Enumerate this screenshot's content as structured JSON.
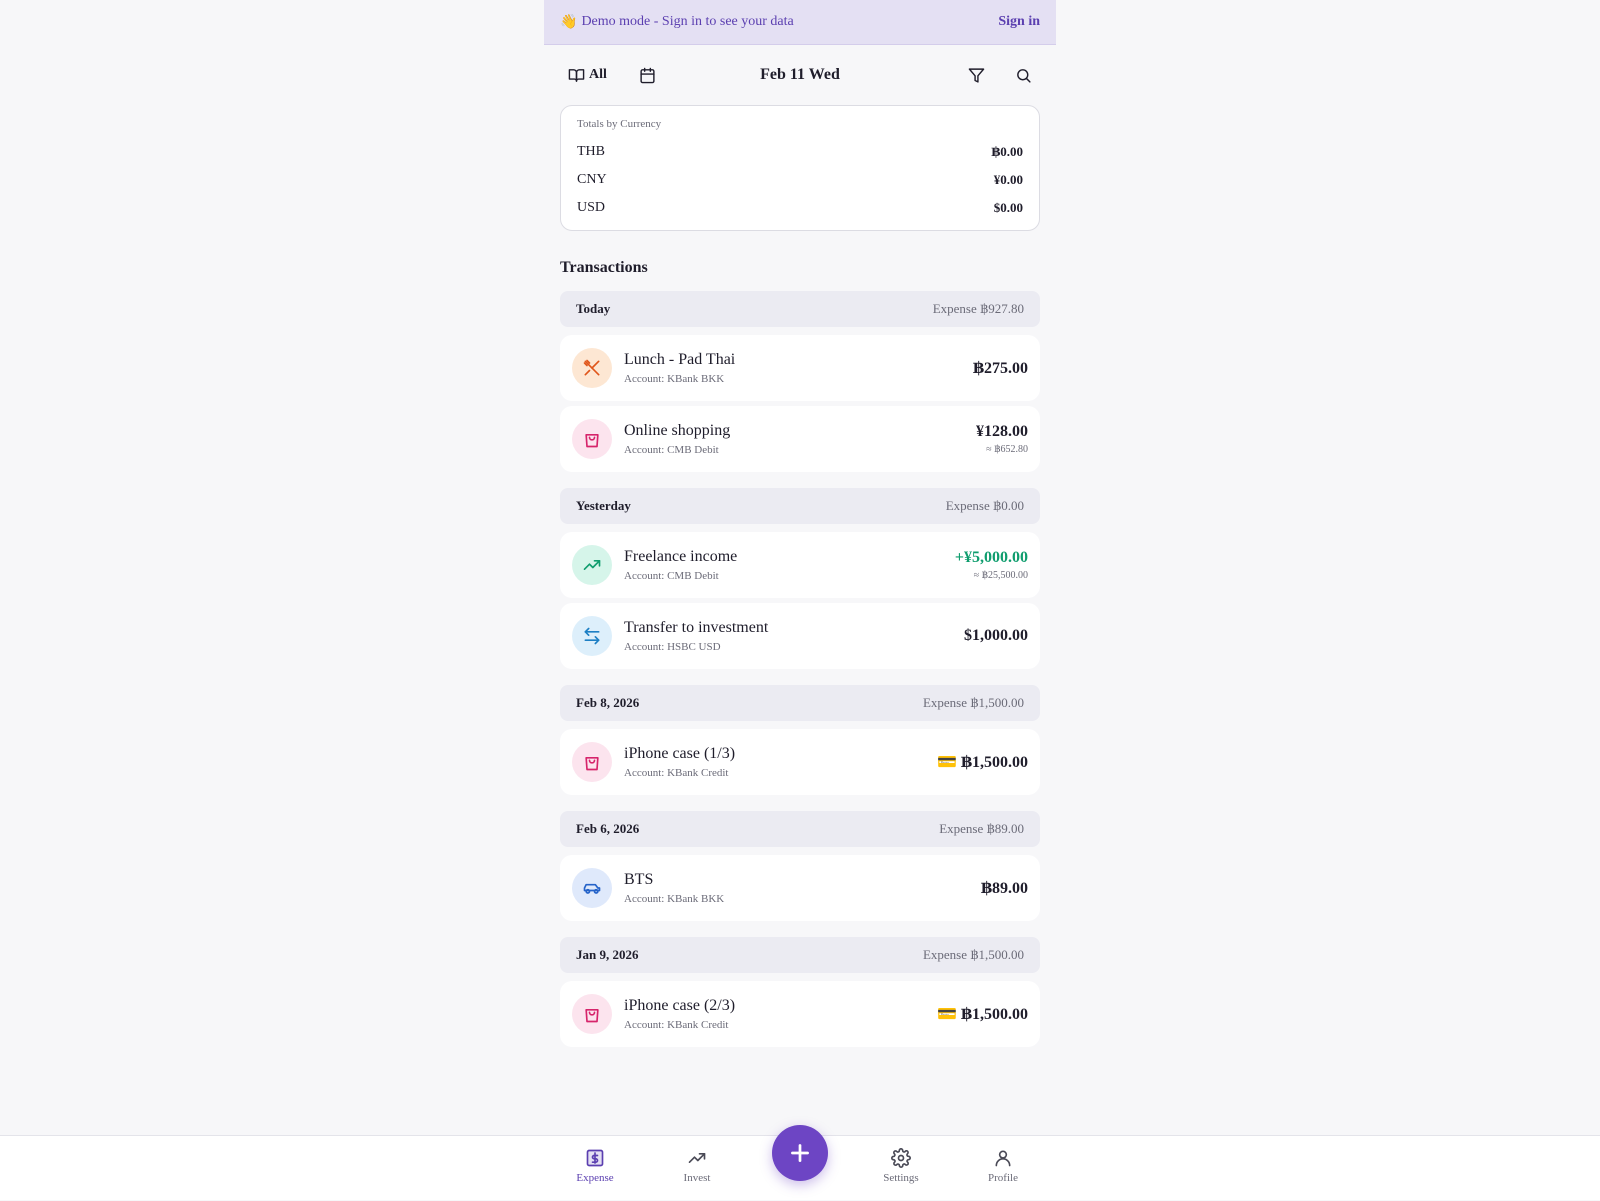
{
  "banner": {
    "emoji": "👋",
    "text": "Demo mode - Sign in to see your data",
    "signin": "Sign in"
  },
  "header": {
    "all_label": "All",
    "date": "Feb 11 Wed"
  },
  "totals": {
    "title": "Totals by Currency",
    "rows": [
      {
        "code": "THB",
        "amount": "฿0.00"
      },
      {
        "code": "CNY",
        "amount": "¥0.00"
      },
      {
        "code": "USD",
        "amount": "$0.00"
      }
    ]
  },
  "transactions_title": "Transactions",
  "groups": [
    {
      "label": "Today",
      "expense": "Expense ฿927.80",
      "items": [
        {
          "name": "Lunch - Pad Thai",
          "account": "Account: KBank BKK",
          "amount": "฿275.00",
          "sub": "",
          "icon": "utensils-icon",
          "type": "expense"
        },
        {
          "name": "Online shopping",
          "account": "Account: CMB Debit",
          "amount": "¥128.00",
          "sub": "≈ ฿652.80",
          "icon": "shopping-bag-icon",
          "type": "expense"
        }
      ]
    },
    {
      "label": "Yesterday",
      "expense": "Expense ฿0.00",
      "items": [
        {
          "name": "Freelance income",
          "account": "Account: CMB Debit",
          "amount": "+¥5,000.00",
          "sub": "≈ ฿25,500.00",
          "icon": "trending-up-icon",
          "type": "income"
        },
        {
          "name": "Transfer to investment",
          "account": "Account: HSBC USD",
          "amount": "$1,000.00",
          "sub": "",
          "icon": "transfer-icon",
          "type": "transfer"
        }
      ]
    },
    {
      "label": "Feb 8, 2026",
      "expense": "Expense ฿1,500.00",
      "items": [
        {
          "name": "iPhone case (1/3)",
          "account": "Account: KBank Credit",
          "amount": "💳 ฿1,500.00",
          "sub": "",
          "icon": "shopping-bag-icon",
          "type": "expense"
        }
      ]
    },
    {
      "label": "Feb 6, 2026",
      "expense": "Expense ฿89.00",
      "items": [
        {
          "name": "BTS",
          "account": "Account: KBank BKK",
          "amount": "฿89.00",
          "sub": "",
          "icon": "car-icon",
          "type": "expense"
        }
      ]
    },
    {
      "label": "Jan 9, 2026",
      "expense": "Expense ฿1,500.00",
      "items": [
        {
          "name": "iPhone case (2/3)",
          "account": "Account: KBank Credit",
          "amount": "💳 ฿1,500.00",
          "sub": "",
          "icon": "shopping-bag-icon",
          "type": "expense"
        }
      ]
    }
  ],
  "nav": {
    "expense": "Expense",
    "invest": "Invest",
    "settings": "Settings",
    "profile": "Profile"
  },
  "colors": {
    "accent": "#6d45c4",
    "income": "#0f9d6e",
    "banner_bg": "#e4e0f3"
  }
}
